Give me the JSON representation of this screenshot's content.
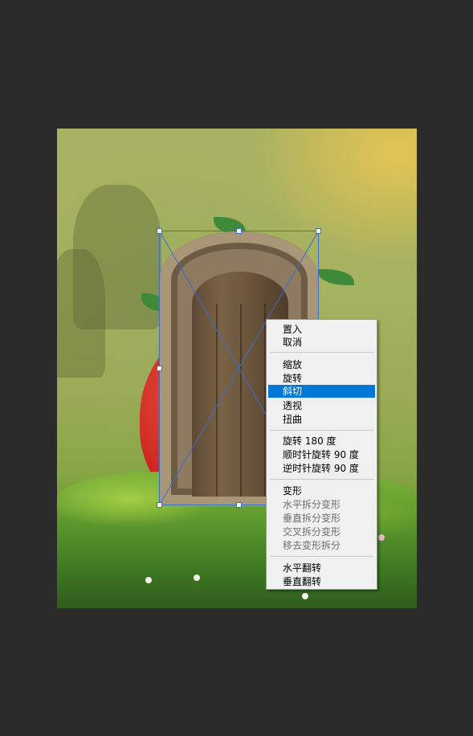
{
  "context_menu": {
    "items": [
      {
        "label": "置入",
        "enabled": true,
        "selected": false
      },
      {
        "label": "取消",
        "enabled": true,
        "selected": false
      },
      {
        "label": "缩放",
        "enabled": true,
        "selected": false
      },
      {
        "label": "旋转",
        "enabled": true,
        "selected": false
      },
      {
        "label": "斜切",
        "enabled": true,
        "selected": true
      },
      {
        "label": "透视",
        "enabled": true,
        "selected": false
      },
      {
        "label": "扭曲",
        "enabled": true,
        "selected": false
      },
      {
        "label": "旋转 180 度",
        "enabled": true,
        "selected": false
      },
      {
        "label": "顺时针旋转 90 度",
        "enabled": true,
        "selected": false
      },
      {
        "label": "逆时针旋转 90 度",
        "enabled": true,
        "selected": false
      },
      {
        "label": "变形",
        "enabled": true,
        "selected": false
      },
      {
        "label": "水平拆分变形",
        "enabled": false,
        "selected": false
      },
      {
        "label": "垂直拆分变形",
        "enabled": false,
        "selected": false
      },
      {
        "label": "交叉拆分变形",
        "enabled": false,
        "selected": false
      },
      {
        "label": "移去变形拆分",
        "enabled": false,
        "selected": false
      },
      {
        "label": "水平翻转",
        "enabled": true,
        "selected": false
      },
      {
        "label": "垂直翻转",
        "enabled": true,
        "selected": false
      }
    ]
  },
  "colors": {
    "workspace_bg": "#2b2b2b",
    "menu_bg": "#f0f0f0",
    "menu_highlight": "#0078d7",
    "transform_box": "#3a6ec9"
  },
  "icons": [
    "transform-handle"
  ]
}
